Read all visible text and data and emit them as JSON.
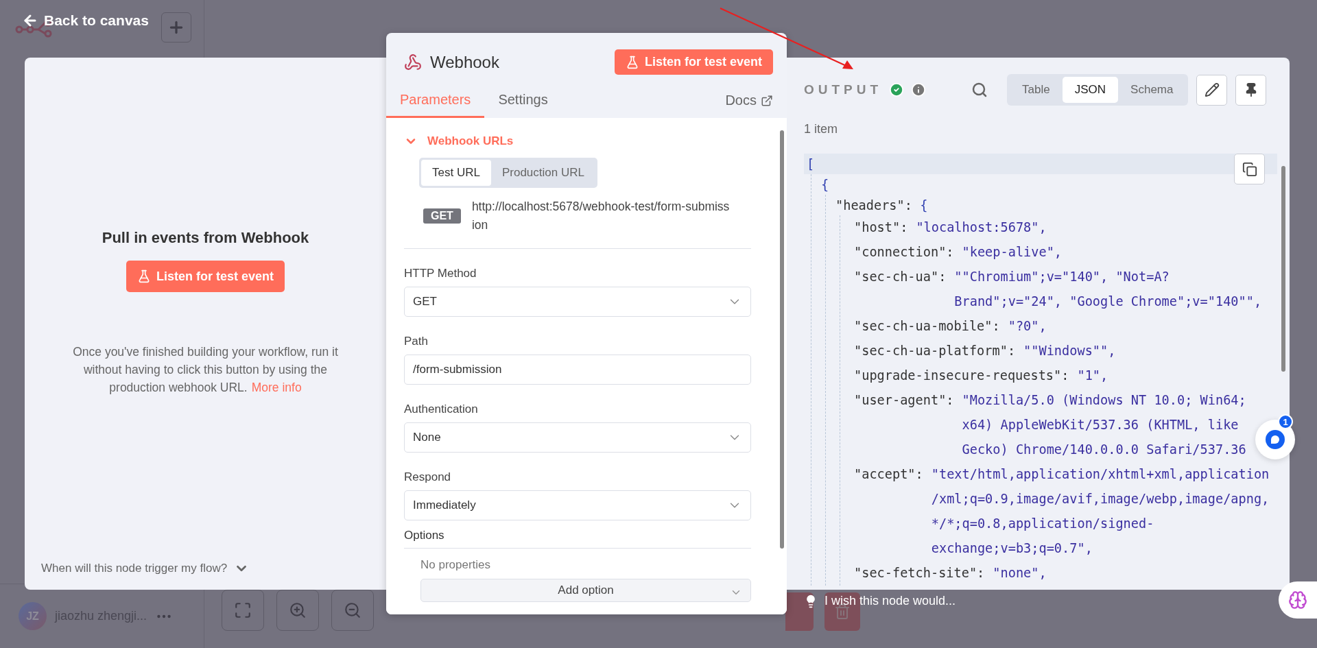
{
  "nav": {
    "back_label": "Back to canvas"
  },
  "sidebar": {
    "user": {
      "initials": "JZ",
      "name": "jiaozhu zhengji..."
    }
  },
  "left_panel": {
    "title": "Pull in events from Webhook",
    "button": "Listen for test event",
    "description": "Once you've finished building your workflow, run it without having to click this button by using the production webhook URL.",
    "link": "More info",
    "footer": "When will this node trigger my flow?"
  },
  "node_panel": {
    "title": "Webhook",
    "button": "Listen for test event",
    "tabs": [
      {
        "label": "Parameters",
        "selected": true
      },
      {
        "label": "Settings",
        "selected": false
      }
    ],
    "docs": "Docs",
    "section": {
      "title": "Webhook URLs",
      "expanded": true,
      "url_tabs": [
        {
          "label": "Test URL",
          "selected": true
        },
        {
          "label": "Production URL",
          "selected": false
        }
      ],
      "method": "GET",
      "url": "http://localhost:5678/webhook-test/form-submission"
    },
    "fields": [
      {
        "kind": "select",
        "label": "HTTP Method",
        "value": "GET"
      },
      {
        "kind": "input",
        "label": "Path",
        "value": "/form-submission"
      },
      {
        "kind": "select",
        "label": "Authentication",
        "value": "None"
      },
      {
        "kind": "select",
        "label": "Respond",
        "value": "Immediately"
      }
    ],
    "options": {
      "title": "Options",
      "empty": "No properties",
      "button": "Add option"
    }
  },
  "output": {
    "title": "OUTPUT",
    "views": [
      {
        "label": "Table",
        "selected": false
      },
      {
        "label": "JSON",
        "selected": true
      },
      {
        "label": "Schema",
        "selected": false
      }
    ],
    "count": "1 item",
    "json": {
      "open": "[",
      "children": [
        {
          "open": "{",
          "children": [
            {
              "key": "\"headers\":",
              "open": "{",
              "children": [
                {
                  "key": "\"host\":",
                  "value": [
                    "\"localhost:5678\","
                  ]
                },
                {
                  "key": "\"connection\":",
                  "value": [
                    "\"keep-alive\","
                  ]
                },
                {
                  "key": "\"sec-ch-ua\":",
                  "value": [
                    "\"\"Chromium\";v=\"140\", \"Not=A?",
                    "Brand\";v=\"24\", \"Google Chrome\";v=\"140\"\","
                  ]
                },
                {
                  "key": "\"sec-ch-ua-mobile\":",
                  "value": [
                    "\"?0\","
                  ]
                },
                {
                  "key": "\"sec-ch-ua-platform\":",
                  "value": [
                    "\"\"Windows\"\","
                  ]
                },
                {
                  "key": "\"upgrade-insecure-requests\":",
                  "value": [
                    "\"1\","
                  ]
                },
                {
                  "key": "\"user-agent\":",
                  "value": [
                    "\"Mozilla/5.0 (Windows NT 10.0; Win64;",
                    "x64) AppleWebKit/537.36 (KHTML, like",
                    "Gecko) Chrome/140.0.0.0 Safari/537.36"
                  ]
                },
                {
                  "key": "\"accept\":",
                  "value": [
                    "\"text/html,application/xhtml+xml,application",
                    "/xml;q=0.9,image/avif,image/webp,image/apng,",
                    "*/*;q=0.8,application/signed-",
                    "exchange;v=b3;q=0.7\","
                  ]
                },
                {
                  "key": "\"sec-fetch-site\":",
                  "value": [
                    "\"none\","
                  ]
                }
              ]
            }
          ]
        }
      ]
    }
  },
  "feedback": "I wish this node would...",
  "chat": {
    "badge": "1"
  }
}
